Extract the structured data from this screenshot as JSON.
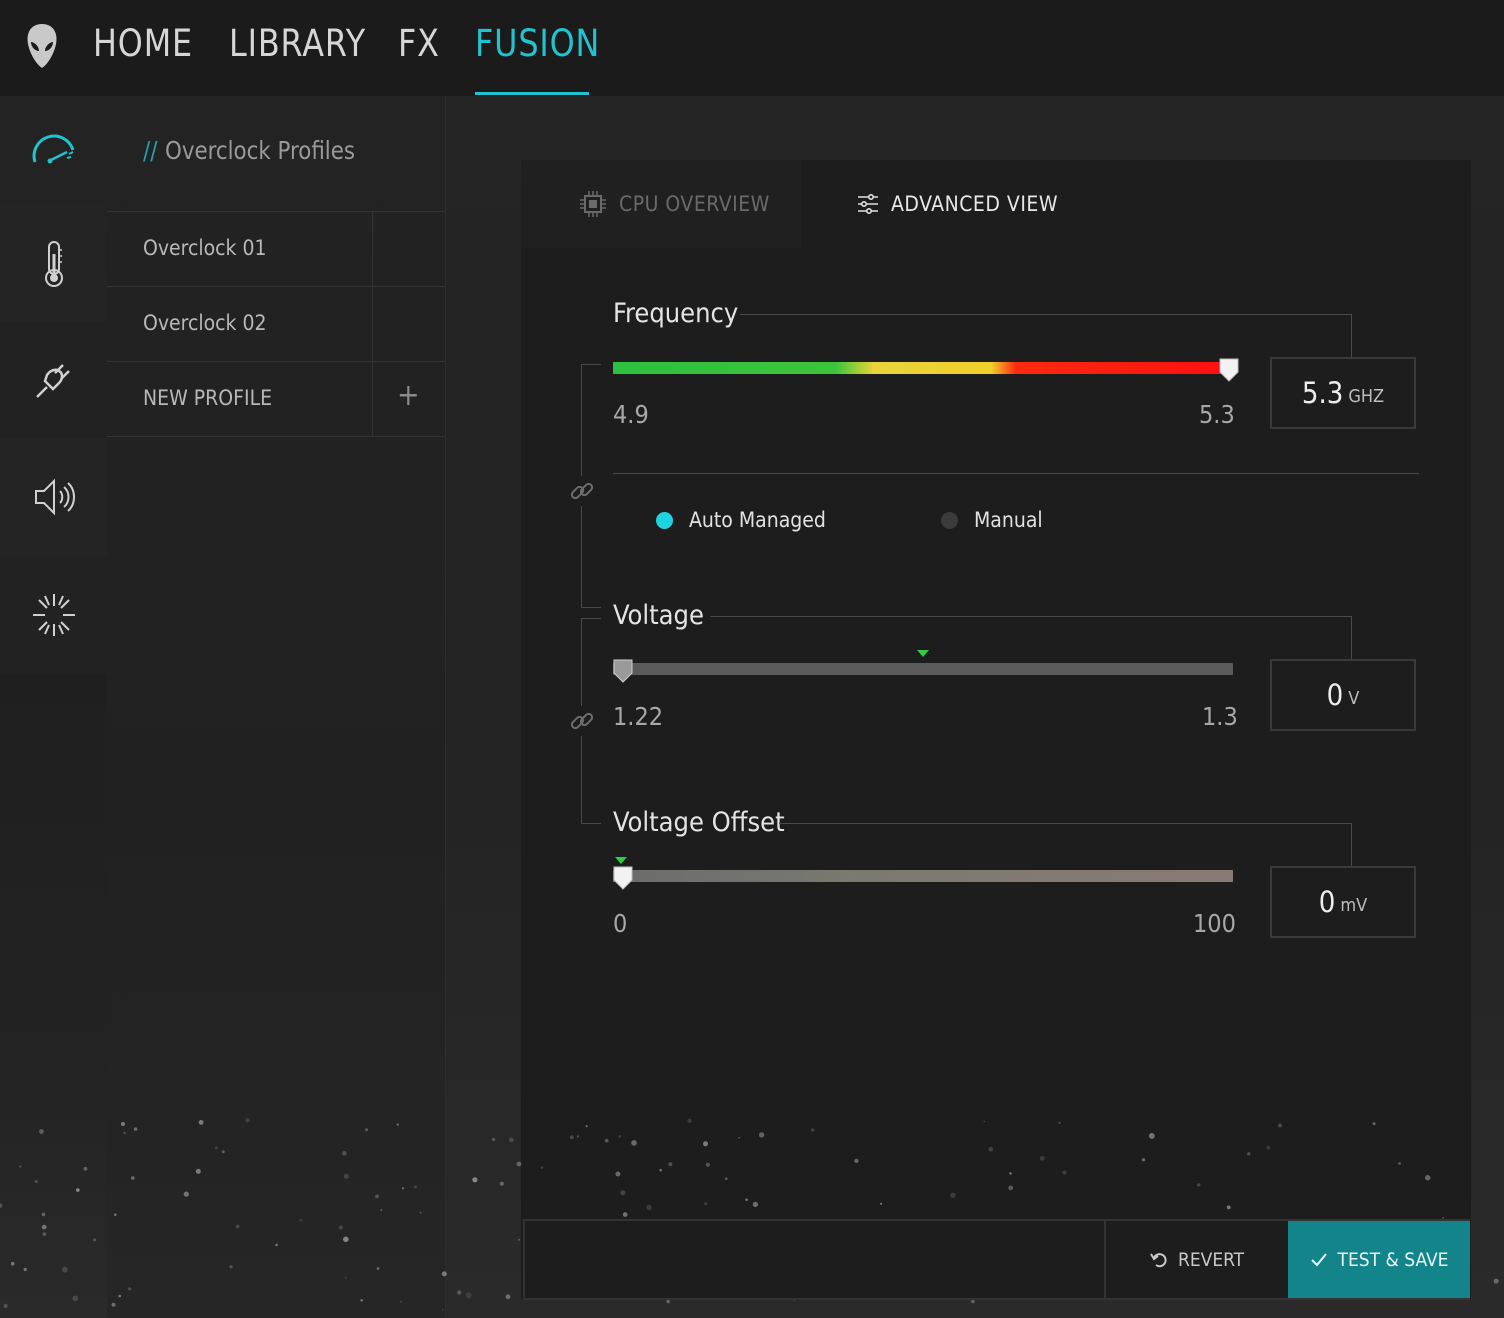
{
  "nav": {
    "items": [
      "HOME",
      "LIBRARY",
      "FX",
      "FUSION"
    ],
    "active": "FUSION"
  },
  "rail": {
    "icons": [
      "speedometer-icon",
      "thermometer-icon",
      "power-plug-icon",
      "speaker-icon",
      "light-burst-icon"
    ]
  },
  "profiles": {
    "title_prefix": "//",
    "title": "Overclock Profiles",
    "items": [
      {
        "label": "Overclock 01",
        "active": true
      },
      {
        "label": "Overclock 02",
        "active": false
      }
    ],
    "new_label": "NEW PROFILE",
    "new_icon": "+"
  },
  "tabs": {
    "cpu": "CPU OVERVIEW",
    "advanced": "ADVANCED VIEW"
  },
  "frequency": {
    "title": "Frequency",
    "min": "4.9",
    "max": "5.3",
    "value": "5.3",
    "unit": "GHZ",
    "level": 1.0
  },
  "mode": {
    "auto": "Auto Managed",
    "manual": "Manual",
    "selected": "auto"
  },
  "voltage": {
    "title": "Voltage",
    "min": "1.22",
    "max": "1.3",
    "value": "0",
    "unit": "V",
    "level": 0.0,
    "marker_level": 0.5
  },
  "voltage_offset": {
    "title": "Voltage Offset",
    "min": "0",
    "max": "100",
    "value": "0",
    "unit": "mV",
    "level": 0.0,
    "marker_level": 0.0
  },
  "actions": {
    "revert": "REVERT",
    "save": "TEST & SAVE"
  },
  "colors": {
    "accent": "#20c3d0",
    "save_button": "#12848a",
    "marker": "#2ecc40"
  }
}
